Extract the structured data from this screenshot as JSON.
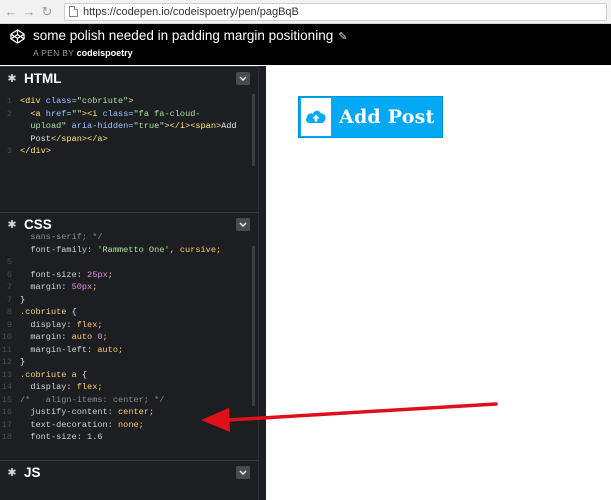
{
  "browser": {
    "url": "https://codepen.io/codeispoetry/pen/pagBqB"
  },
  "pen": {
    "title": "some polish needed in padding margin positioning",
    "by_label": "A PEN BY",
    "author": "codeispoetry"
  },
  "panels": {
    "html": {
      "title": "HTML",
      "lines": [
        {
          "n": "1",
          "segments": [
            {
              "c": "tag",
              "t": "<div "
            },
            {
              "c": "attr",
              "t": "class="
            },
            {
              "c": "str",
              "t": "\"cobriute\""
            },
            {
              "c": "tag",
              "t": ">"
            }
          ]
        },
        {
          "n": "2",
          "segments": [
            {
              "c": "tag",
              "t": "  <a "
            },
            {
              "c": "attr",
              "t": "href="
            },
            {
              "c": "str",
              "t": "\"\""
            },
            {
              "c": "tag",
              "t": "><i "
            },
            {
              "c": "attr",
              "t": "class="
            },
            {
              "c": "str",
              "t": "\"fa fa-cloud-"
            }
          ]
        },
        {
          "n": "",
          "segments": [
            {
              "c": "str",
              "t": "  upload\""
            },
            {
              "c": "attr",
              "t": " aria-hidden="
            },
            {
              "c": "str",
              "t": "\"true\""
            },
            {
              "c": "tag",
              "t": "></i><span>"
            },
            {
              "c": "code",
              "t": "Add"
            }
          ]
        },
        {
          "n": "",
          "segments": [
            {
              "c": "code",
              "t": "  Post"
            },
            {
              "c": "tag",
              "t": "</span></a>"
            }
          ]
        },
        {
          "n": "3",
          "segments": [
            {
              "c": "tag",
              "t": "</div>"
            }
          ]
        }
      ]
    },
    "css": {
      "title": "CSS",
      "lines": [
        {
          "n": "",
          "segments": [
            {
              "c": "com",
              "t": "  sans-serif; */"
            }
          ]
        },
        {
          "n": "",
          "segments": [
            {
              "c": "prop",
              "t": "  font-family: "
            },
            {
              "c": "str",
              "t": "'Rammetto One'"
            },
            {
              "c": "val",
              "t": ", cursive;"
            }
          ]
        },
        {
          "n": "",
          "segments": [
            {
              "c": "code",
              "t": ""
            }
          ]
        },
        {
          "n": "",
          "segments": [
            {
              "c": "prop",
              "t": "  font-size: "
            },
            {
              "c": "num",
              "t": "25px"
            },
            {
              "c": "val",
              "t": ";"
            }
          ]
        },
        {
          "n": "",
          "segments": [
            {
              "c": "prop",
              "t": "  margin: "
            },
            {
              "c": "num",
              "t": "50px"
            },
            {
              "c": "val",
              "t": ";"
            }
          ]
        },
        {
          "n": "",
          "segments": [
            {
              "c": "code",
              "t": "}"
            }
          ]
        },
        {
          "n": "8",
          "segments": [
            {
              "c": "sel",
              "t": ".cobriute"
            },
            {
              "c": "code",
              "t": " {"
            }
          ]
        },
        {
          "n": "9",
          "segments": [
            {
              "c": "prop",
              "t": "  display: "
            },
            {
              "c": "val",
              "t": "flex;"
            }
          ]
        },
        {
          "n": "10",
          "segments": [
            {
              "c": "prop",
              "t": "  margin: "
            },
            {
              "c": "val",
              "t": "auto "
            },
            {
              "c": "num",
              "t": "0"
            },
            {
              "c": "val",
              "t": ";"
            }
          ]
        },
        {
          "n": "11",
          "segments": [
            {
              "c": "prop",
              "t": "  margin-left: "
            },
            {
              "c": "val",
              "t": "auto;"
            }
          ]
        },
        {
          "n": "12",
          "segments": [
            {
              "c": "code",
              "t": "}"
            }
          ]
        },
        {
          "n": "13",
          "segments": [
            {
              "c": "sel",
              "t": ".cobriute a"
            },
            {
              "c": "code",
              "t": " {"
            }
          ]
        },
        {
          "n": "14",
          "segments": [
            {
              "c": "prop",
              "t": "  display: "
            },
            {
              "c": "val",
              "t": "flex;"
            }
          ]
        },
        {
          "n": "15",
          "segments": [
            {
              "c": "com",
              "t": "/*   align-items: center; */"
            }
          ]
        },
        {
          "n": "16",
          "segments": [
            {
              "c": "prop",
              "t": "  justify-content: "
            },
            {
              "c": "val",
              "t": "center;"
            }
          ]
        },
        {
          "n": "17",
          "segments": [
            {
              "c": "prop",
              "t": "  text-decoration: "
            },
            {
              "c": "val",
              "t": "none;"
            }
          ]
        },
        {
          "n": "18",
          "segments": [
            {
              "c": "prop",
              "t": "  font-size: 1.6"
            }
          ]
        }
      ]
    },
    "js": {
      "title": "JS"
    }
  },
  "preview": {
    "button_label": "Add Post",
    "icon": "cloud-upload-icon",
    "color": "#03a9f4"
  },
  "annotation": {
    "arrow_color": "#e0101a"
  }
}
